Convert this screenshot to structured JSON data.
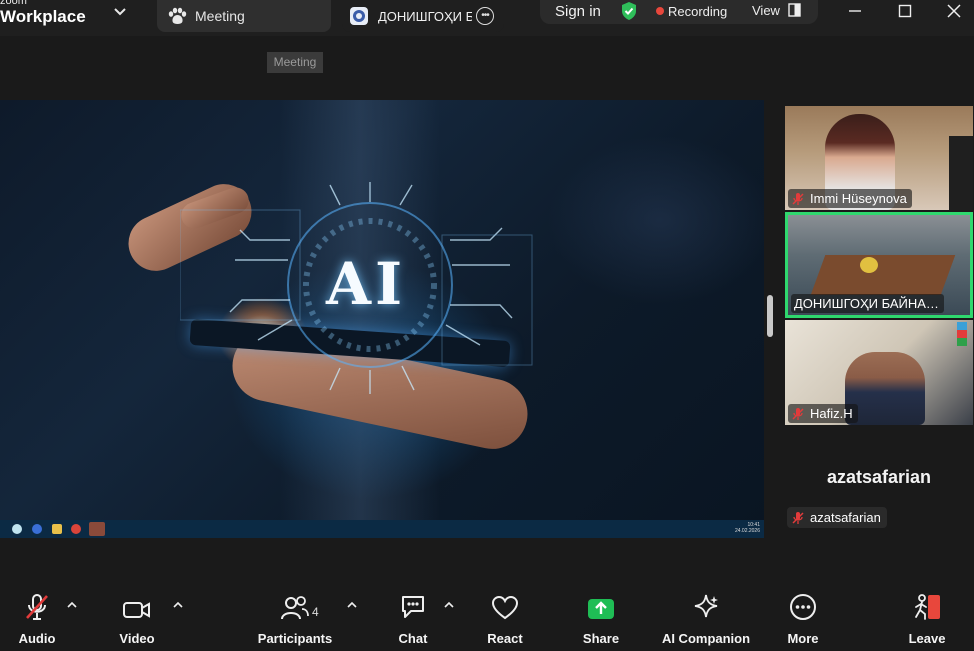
{
  "window": {
    "brand_small": "zoom",
    "brand_name": "Workplace"
  },
  "tabs": [
    {
      "label": "Meeting",
      "icon": "paw-icon"
    },
    {
      "label": "ДОНИШГОҲИ Б",
      "icon": "document-icon"
    }
  ],
  "status": {
    "signin": "Sign in",
    "recording": "Recording",
    "view": "View",
    "recording_color": "#e8473c",
    "shield_color": "#2fbe5a"
  },
  "tooltip": "Meeting",
  "share": {
    "headline": "AI",
    "clock_time": "10:41",
    "clock_date": "24.02.2026"
  },
  "participants": [
    {
      "name": "Immi Hüseynova",
      "muted": true
    },
    {
      "name": "ДОНИШГОҲИ БАЙНА…",
      "muted": false,
      "active_speaker": true
    },
    {
      "name": "Hafiz.H",
      "muted": true
    }
  ],
  "self_view": {
    "display_name": "azatsafarian",
    "tag_name": "azatsafarian",
    "muted": true
  },
  "toolbar": {
    "audio": "Audio",
    "video": "Video",
    "participants": "Participants",
    "participants_count": "4",
    "chat": "Chat",
    "react": "React",
    "share": "Share",
    "ai_companion": "AI Companion",
    "more": "More",
    "leave": "Leave",
    "share_color": "#1fbd55",
    "leave_color": "#e8473c"
  }
}
